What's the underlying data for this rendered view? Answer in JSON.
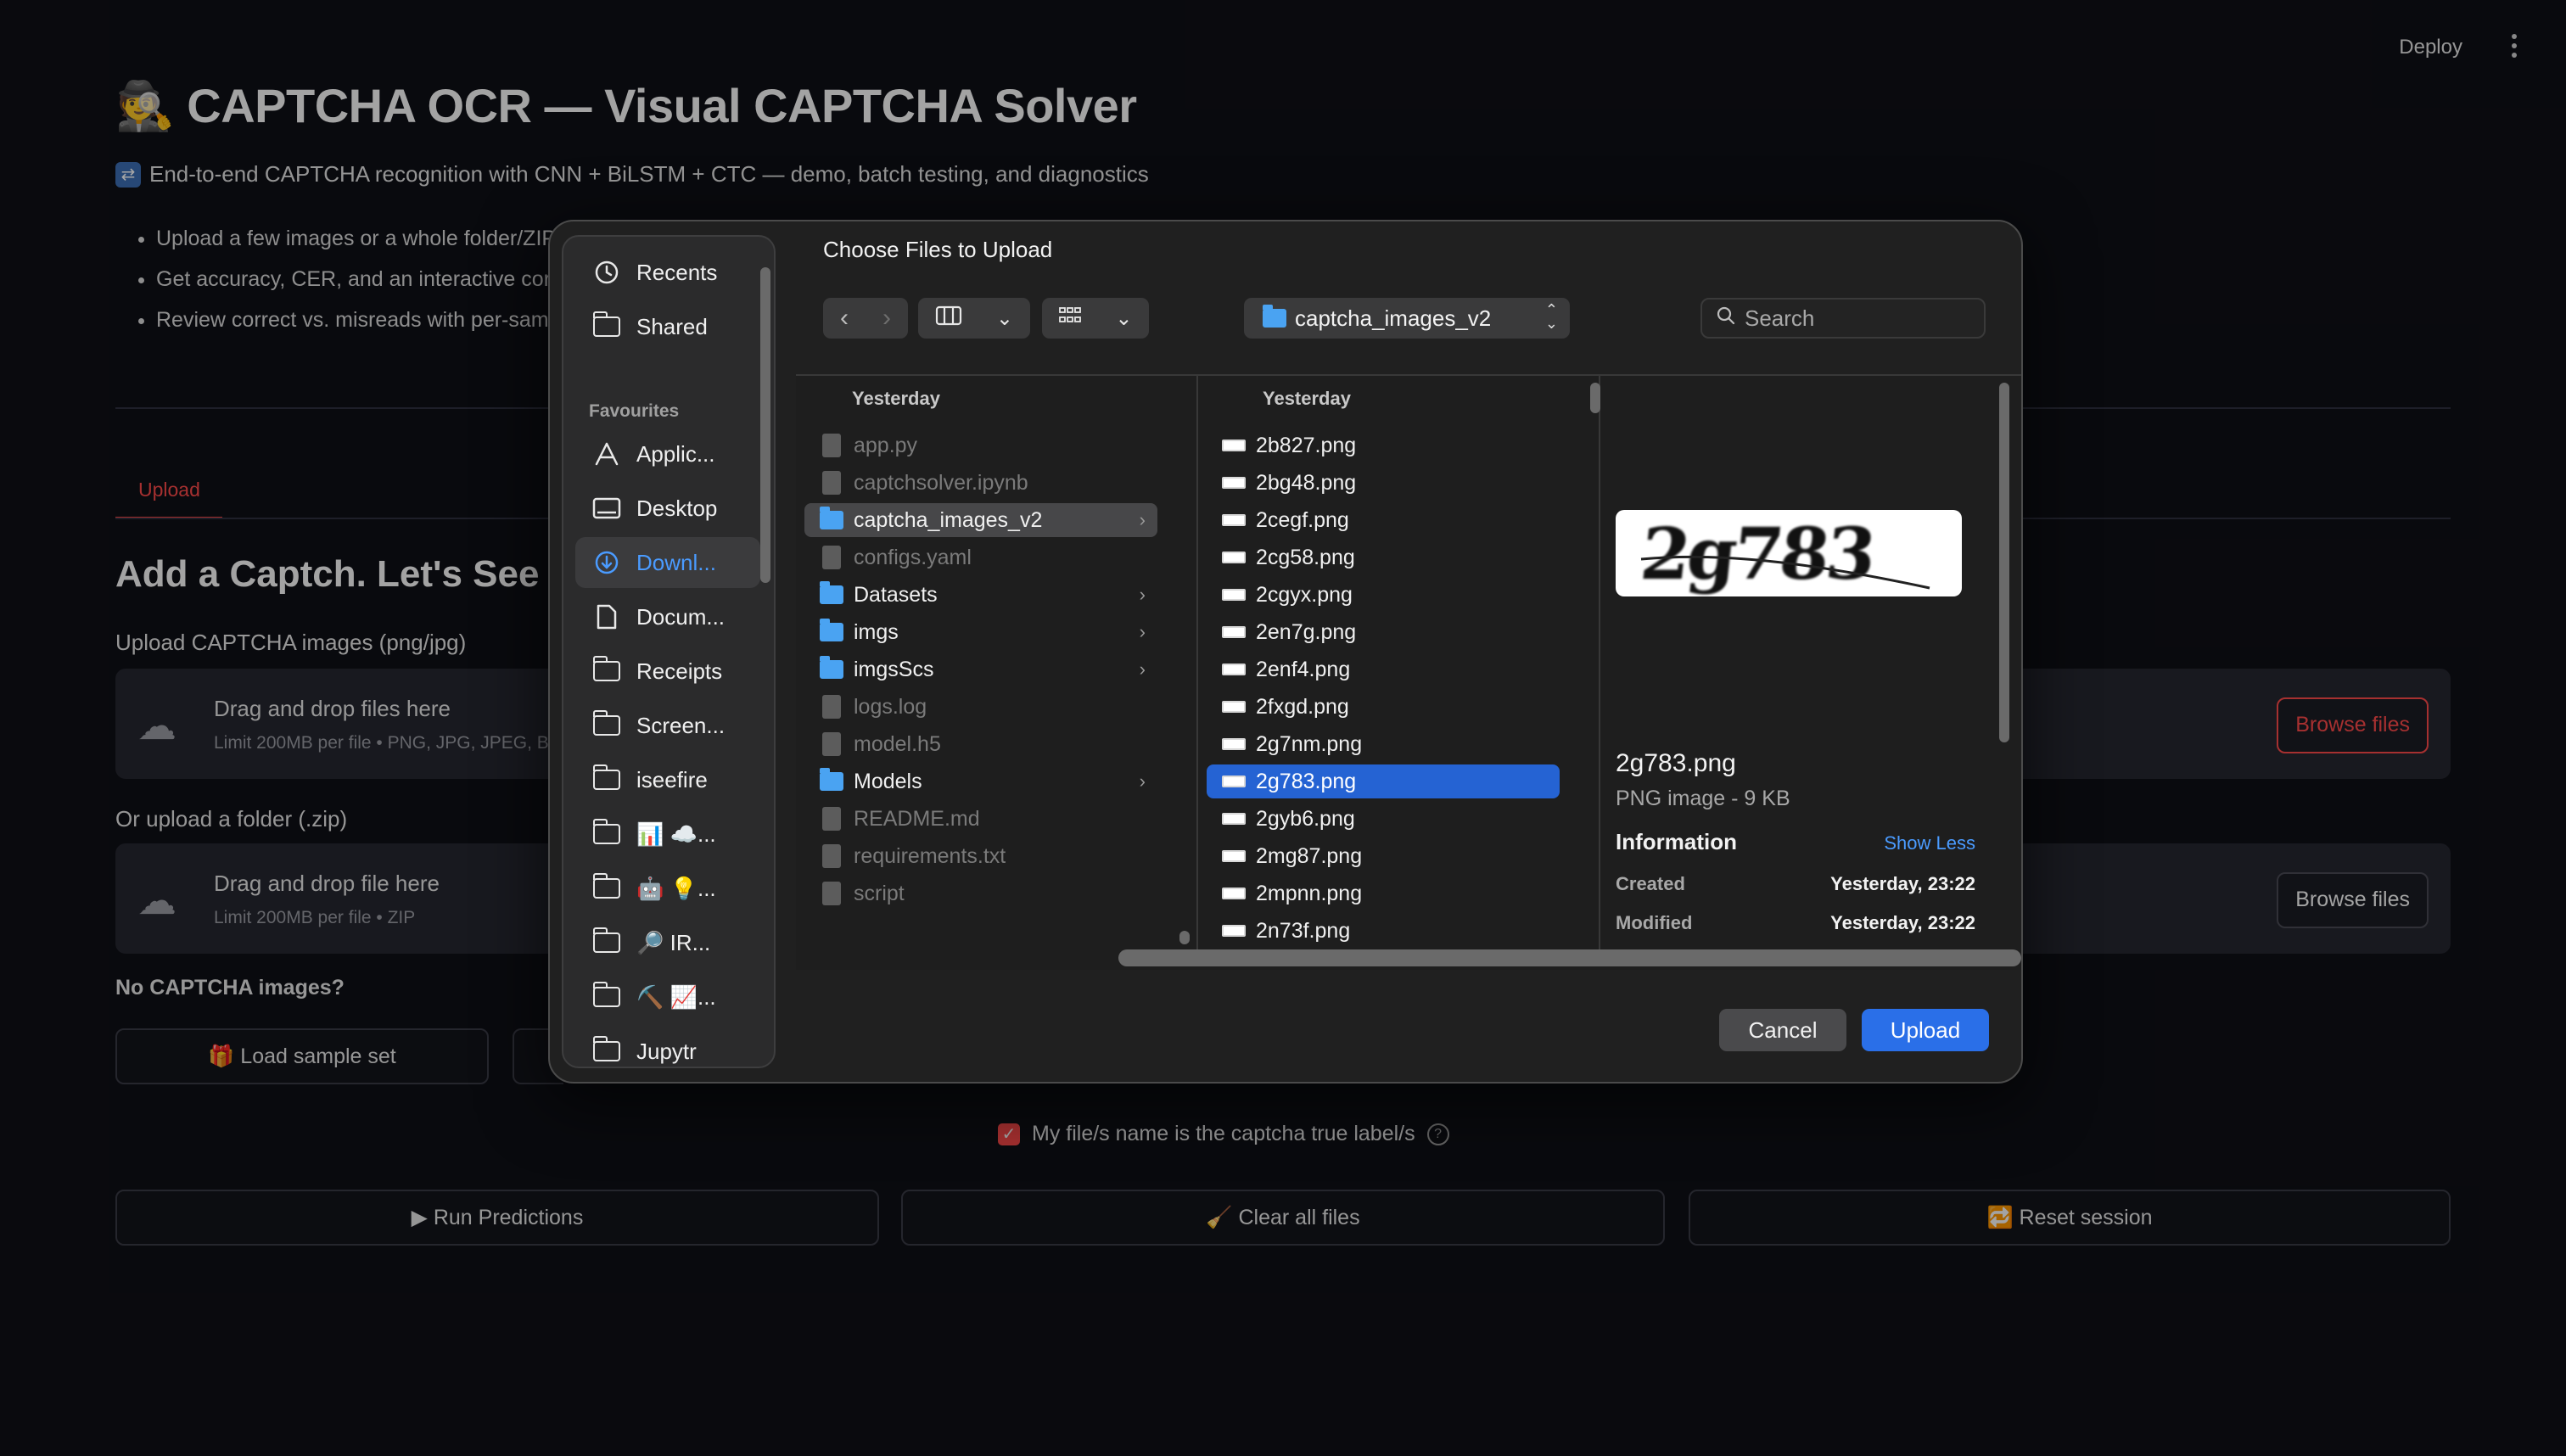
{
  "app": {
    "deploy_label": "Deploy",
    "title": "🕵️ CAPTCHA OCR — Visual CAPTCHA Solver",
    "subtitle": "End-to-end CAPTCHA recognition with CNN + BiLSTM + CTC — demo, batch testing, and diagnostics",
    "subtitle_icon": "shuffle-icon",
    "bullets": [
      "Upload a few images or a whole folder/ZIP",
      "Get accuracy, CER, and an interactive cor",
      "Review correct vs. misreads with per-sam"
    ],
    "tab_upload": "Upload",
    "heading": "Add a Captch. Let's See Ho",
    "upload_images_label": "Upload CAPTCHA images (png/jpg)",
    "dz1_main": "Drag and drop files here",
    "dz1_sub": "Limit 200MB per file • PNG, JPG, JPEG, B",
    "browse1": "Browse files",
    "upload_folder_label": "Or upload a folder (.zip)",
    "dz2_main": "Drag and drop file here",
    "dz2_sub": "Limit 200MB per file • ZIP",
    "browse2": "Browse files",
    "no_captcha": "No CAPTCHA images?",
    "load_sample": "🎁 Load sample set",
    "checkbox_label": "My file/s name is the captcha true label/s",
    "checkbox_checked": true,
    "run_predictions": "▶ Run Predictions",
    "clear_files": "🧹 Clear all files",
    "reset_session": "🔁 Reset session",
    "accent_color": "#ff4b4b"
  },
  "dialog": {
    "title": "Choose Files to Upload",
    "path": "captcha_images_v2",
    "search_placeholder": "Search",
    "sidebar": {
      "top": [
        {
          "label": "Recents",
          "icon": "clock-icon"
        },
        {
          "label": "Shared",
          "icon": "shared-folder-icon"
        }
      ],
      "favourites_header": "Favourites",
      "favourites": [
        {
          "label": "Applic...",
          "icon": "applications-icon",
          "active": false
        },
        {
          "label": "Desktop",
          "icon": "desktop-icon",
          "active": false
        },
        {
          "label": "Downl...",
          "icon": "download-icon",
          "active": true
        },
        {
          "label": "Docum...",
          "icon": "document-icon",
          "active": false
        },
        {
          "label": "Receipts",
          "icon": "folder-icon",
          "active": false
        },
        {
          "label": "Screen...",
          "icon": "folder-icon",
          "active": false
        },
        {
          "label": "iseefire",
          "icon": "folder-icon",
          "active": false
        },
        {
          "label": "📊 ☁️...",
          "icon": "folder-icon",
          "active": false
        },
        {
          "label": "🤖 💡...",
          "icon": "folder-icon",
          "active": false
        },
        {
          "label": "🔎 IR...",
          "icon": "folder-icon",
          "active": false
        },
        {
          "label": "⛏️ 📈...",
          "icon": "folder-icon",
          "active": false
        },
        {
          "label": "Jupytr",
          "icon": "folder-icon",
          "active": false
        }
      ]
    },
    "col1": {
      "header": "Yesterday",
      "items": [
        {
          "name": "app.py",
          "type": "doc",
          "dim": true
        },
        {
          "name": "captchsolver.ipynb",
          "type": "doc",
          "dim": true
        },
        {
          "name": "captcha_images_v2",
          "type": "folder",
          "dim": false,
          "selected": true,
          "chevron": true
        },
        {
          "name": "configs.yaml",
          "type": "doc",
          "dim": true
        },
        {
          "name": "Datasets",
          "type": "folder",
          "dim": false,
          "chevron": true
        },
        {
          "name": "imgs",
          "type": "folder",
          "dim": false,
          "chevron": true
        },
        {
          "name": "imgsScs",
          "type": "folder",
          "dim": false,
          "chevron": true
        },
        {
          "name": "logs.log",
          "type": "doc",
          "dim": true
        },
        {
          "name": "model.h5",
          "type": "doc",
          "dim": true
        },
        {
          "name": "Models",
          "type": "folder",
          "dim": false,
          "chevron": true
        },
        {
          "name": "README.md",
          "type": "doc",
          "dim": true
        },
        {
          "name": "requirements.txt",
          "type": "doc",
          "dim": true
        },
        {
          "name": "script",
          "type": "doc",
          "dim": true
        }
      ]
    },
    "col2": {
      "header": "Yesterday",
      "items": [
        "2b827.png",
        "2bg48.png",
        "2cegf.png",
        "2cg58.png",
        "2cgyx.png",
        "2en7g.png",
        "2enf4.png",
        "2fxgd.png",
        "2g7nm.png",
        "2g783.png",
        "2gyb6.png",
        "2mg87.png",
        "2mpnn.png",
        "2n73f.png"
      ],
      "selected_index": 9
    },
    "preview": {
      "captcha_text": "2g783",
      "filename": "2g783.png",
      "kind": "PNG image - 9 KB",
      "info_label": "Information",
      "show_less": "Show Less",
      "created_label": "Created",
      "created_value": "Yesterday, 23:22",
      "modified_label": "Modified",
      "modified_value": "Yesterday, 23:22"
    },
    "cancel": "Cancel",
    "upload": "Upload"
  }
}
